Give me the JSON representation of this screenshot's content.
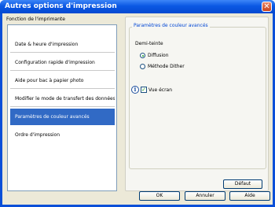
{
  "window": {
    "title": "Autres options d'impression",
    "close_label": "✕"
  },
  "left": {
    "title": "Fonction de l'imprimante",
    "items": [
      {
        "label": "Date & heure d'impression",
        "selected": false
      },
      {
        "label": "Configuration rapide d'impression",
        "selected": false
      },
      {
        "label": "Aide pour bac à papier photo",
        "selected": false
      },
      {
        "label": "Modifier le mode de transfert des données",
        "selected": false
      },
      {
        "label": "Paramètres de couleur avancés",
        "selected": true
      },
      {
        "label": "Ordre d'impression",
        "selected": false
      }
    ]
  },
  "right": {
    "group_title": "Paramètres de couleur avancés",
    "halftone_label": "Demi-teinte",
    "options": [
      {
        "label": "Diffusion",
        "checked": true
      },
      {
        "label": "Méthode Dither",
        "checked": false
      }
    ],
    "preview_label": "Vue écran",
    "preview_checked": true,
    "info_icon": "i",
    "default_button": "Défaut"
  },
  "footer": {
    "ok": "OK",
    "cancel": "Annuler",
    "help": "Aide"
  }
}
